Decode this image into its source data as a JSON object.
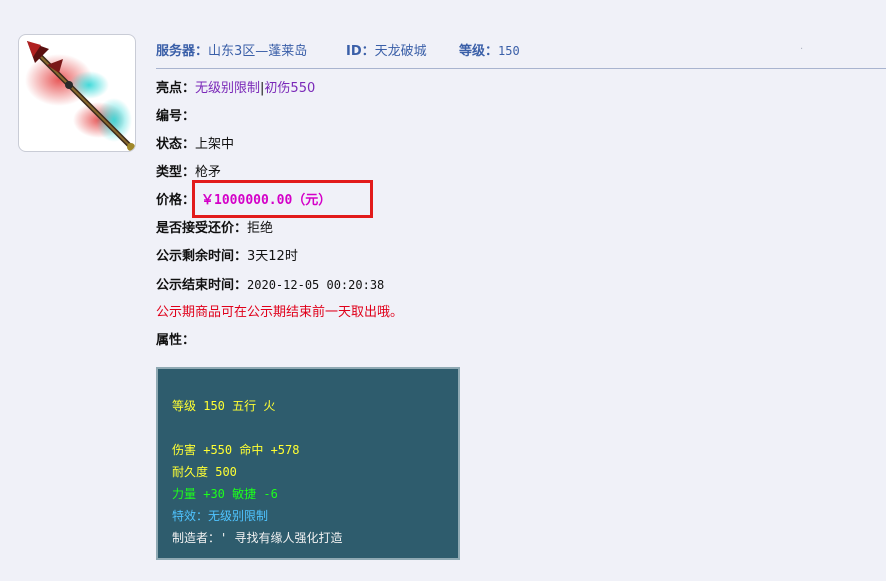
{
  "header": {
    "server_label": "服务器：",
    "server_value": "山东3区—蓬莱岛",
    "id_label": "ID：",
    "id_value": "天龙破城",
    "level_label": "等级：",
    "level_value": "150"
  },
  "fields": {
    "highlight_label": "亮点：",
    "highlight_value": "无级别限制",
    "highlight_sep": "|",
    "highlight_extra": "初伤550",
    "serial_label": "编号：",
    "status_label": "状态：",
    "status_value": "上架中",
    "type_label": "类型：",
    "type_value": "枪矛",
    "price_label": "价格：",
    "price_value": "￥1000000.00（元）",
    "bargain_label": "是否接受还价：",
    "bargain_value": "拒绝",
    "remaining_label": "公示剩余时间：",
    "remaining_value": "3天12时",
    "end_label": "公示结束时间：",
    "end_value": "2020-12-05 00:20:38",
    "notice": "公示期商品可在公示期结束前一天取出哦。",
    "attr_label": "属性："
  },
  "attributes": {
    "line1": "等级 150 五行 火",
    "line2": "伤害 +550 命中 +578",
    "line3": "耐久度 500",
    "line4": "力量 +30 敏捷 -6",
    "line5": "特效：无级别限制",
    "line6": "制造者：' 寻找有缘人强化打造"
  },
  "thumbnail": {
    "icon": "spear-weapon-icon"
  },
  "colors": {
    "price": "#d400c8",
    "highlight": "#7a28b8",
    "notice": "#e0001a",
    "panel_bg": "#2e5c6d",
    "attr_yellow": "#ffff33",
    "attr_green": "#1cff1c",
    "attr_cyan": "#4fc3ff",
    "box_border": "#e21b1b"
  }
}
